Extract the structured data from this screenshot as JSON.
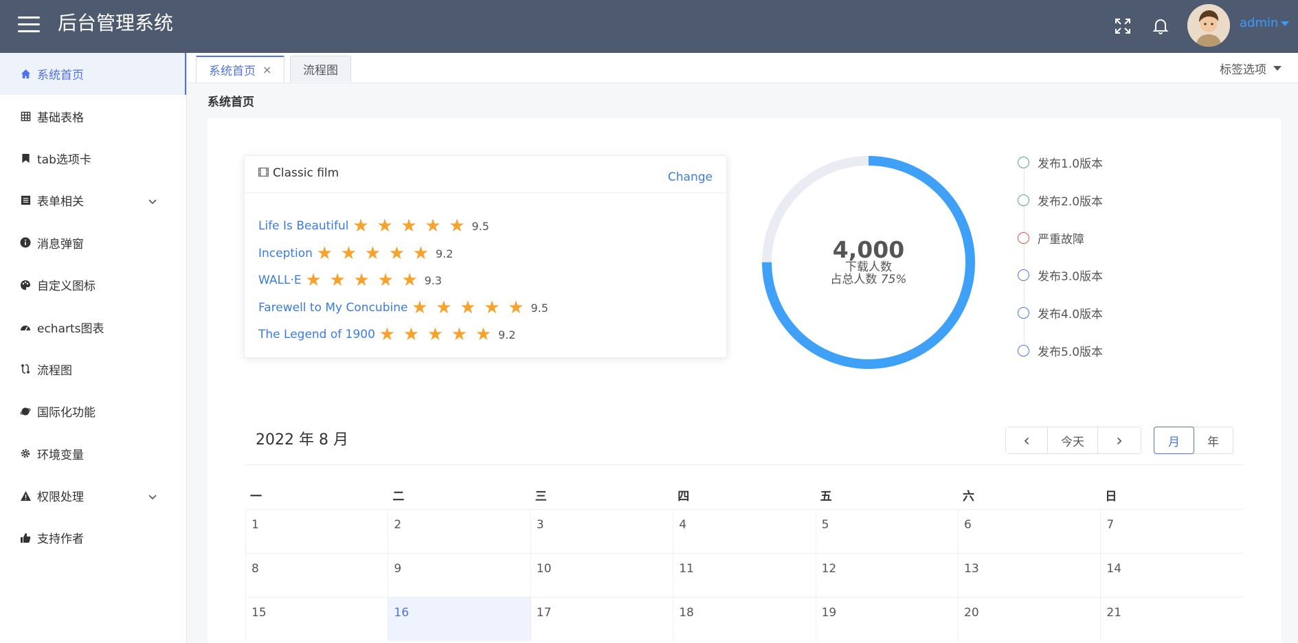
{
  "header": {
    "title": "后台管理系统",
    "username": "admin",
    "icons": [
      "menu-icon",
      "fullscreen-icon",
      "bell-icon"
    ]
  },
  "sidebar": {
    "items": [
      {
        "label": "系统首页",
        "icon": "home-icon",
        "active": true
      },
      {
        "label": "基础表格",
        "icon": "grid-icon"
      },
      {
        "label": "tab选项卡",
        "icon": "bookmark-icon"
      },
      {
        "label": "表单相关",
        "icon": "list-icon",
        "expandable": true
      },
      {
        "label": "消息弹窗",
        "icon": "info-icon"
      },
      {
        "label": "自定义图标",
        "icon": "palette-icon"
      },
      {
        "label": "echarts图表",
        "icon": "chart-icon"
      },
      {
        "label": "流程图",
        "icon": "flow-icon"
      },
      {
        "label": "国际化功能",
        "icon": "globe-icon"
      },
      {
        "label": "环境变量",
        "icon": "gear-icon"
      },
      {
        "label": "权限处理",
        "icon": "warning-icon",
        "expandable": true
      },
      {
        "label": "支持作者",
        "icon": "thumbs-up-icon"
      }
    ]
  },
  "tabs": {
    "items": [
      {
        "label": "系统首页",
        "active": true,
        "closable": true,
        "close_glyph": "×"
      },
      {
        "label": "流程图"
      }
    ],
    "options_label": "标签选项"
  },
  "page": {
    "heading": "系统首页"
  },
  "films": {
    "title": "Classic film",
    "change_label": "Change",
    "items": [
      {
        "name": "Life Is Beautiful",
        "rating": 5,
        "score": "9.5"
      },
      {
        "name": "Inception",
        "rating": 5,
        "score": "9.2"
      },
      {
        "name": "WALL·E",
        "rating": 5,
        "score": "9.3"
      },
      {
        "name": "Farewell to My Concubine",
        "rating": 5,
        "score": "9.5"
      },
      {
        "name": "The Legend of 1900",
        "rating": 5,
        "score": "9.2"
      }
    ]
  },
  "donut": {
    "value": "4,000",
    "label": "下载人数",
    "ratio_label": "占总人数",
    "ratio": "75%",
    "progress": 0.75,
    "track_color": "#e9edf3",
    "fill_color": "#3fa0f7"
  },
  "timeline": {
    "items": [
      {
        "text": "发布1.0版本",
        "color": "#4caf7a"
      },
      {
        "text": "发布2.0版本",
        "color": "#4caf7a"
      },
      {
        "text": "严重故障",
        "color": "#e15241"
      },
      {
        "text": "发布3.0版本",
        "color": "#4f73e6"
      },
      {
        "text": "发布4.0版本",
        "color": "#4f73e6"
      },
      {
        "text": "发布5.0版本",
        "color": "#4f73e6"
      }
    ]
  },
  "calendar": {
    "title": "2022 年 8 月",
    "today_label": "今天",
    "prev_glyph": "‹",
    "next_glyph": "›",
    "view_month": "月",
    "view_year": "年",
    "weekdays": [
      "一",
      "二",
      "三",
      "四",
      "五",
      "六",
      "日"
    ],
    "days": [
      "1",
      "2",
      "3",
      "4",
      "5",
      "6",
      "7",
      "8",
      "9",
      "10",
      "11",
      "12",
      "13",
      "14",
      "15",
      "16",
      "17",
      "18",
      "19",
      "20",
      "21"
    ],
    "selected_day": "16"
  }
}
